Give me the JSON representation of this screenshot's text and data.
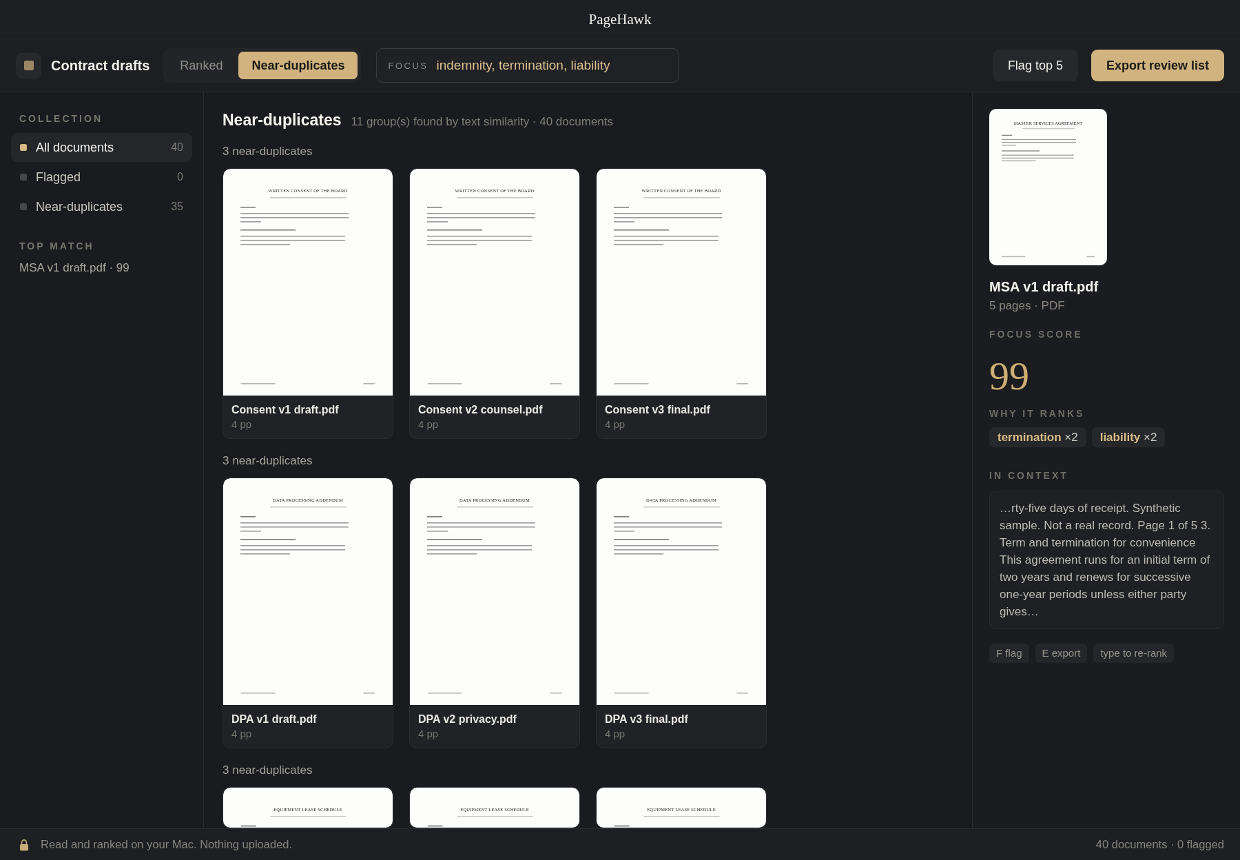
{
  "window": {
    "title": "PageHawk"
  },
  "toolbar": {
    "collection_title": "Contract drafts",
    "view_tabs": [
      {
        "label": "Ranked",
        "selected": false
      },
      {
        "label": "Near-duplicates",
        "selected": true
      }
    ],
    "focus": {
      "label": "FOCUS",
      "value": "indemnity, termination, liability"
    },
    "buttons": [
      {
        "label": "Flag top 5",
        "kind": "secondary"
      },
      {
        "label": "Export review list",
        "kind": "primary"
      }
    ]
  },
  "sidebar": {
    "collection": {
      "heading": "COLLECTION",
      "items": [
        {
          "label": "All documents",
          "count": "40",
          "selected": true
        },
        {
          "label": "Flagged",
          "count": "0",
          "selected": false
        },
        {
          "label": "Near-duplicates",
          "count": "35",
          "selected": false
        }
      ]
    },
    "top_match": {
      "heading": "TOP MATCH",
      "text": "MSA v1 draft.pdf · 99"
    }
  },
  "main": {
    "title": "Near-duplicates",
    "summary": "11 group(s) found by text similarity · 40 documents",
    "groups": [
      {
        "label": "3 near-duplicates",
        "documents": [
          {
            "page_title": "WRITTEN CONSENT OF THE BOARD",
            "name": "Consent v1 draft.pdf",
            "pages": "4 pp"
          },
          {
            "page_title": "WRITTEN CONSENT OF THE BOARD",
            "name": "Consent v2 counsel.pdf",
            "pages": "4 pp"
          },
          {
            "page_title": "WRITTEN CONSENT OF THE BOARD",
            "name": "Consent v3 final.pdf",
            "pages": "4 pp"
          }
        ]
      },
      {
        "label": "3 near-duplicates",
        "documents": [
          {
            "page_title": "DATA PROCESSING ADDENDUM",
            "name": "DPA v1 draft.pdf",
            "pages": "4 pp"
          },
          {
            "page_title": "DATA PROCESSING ADDENDUM",
            "name": "DPA v2 privacy.pdf",
            "pages": "4 pp"
          },
          {
            "page_title": "DATA PROCESSING ADDENDUM",
            "name": "DPA v3 final.pdf",
            "pages": "4 pp"
          }
        ]
      },
      {
        "label": "3 near-duplicates",
        "documents": [
          {
            "page_title": "EQUIPMENT LEASE SCHEDULE"
          },
          {
            "page_title": "EQUIPMENT LEASE SCHEDULE"
          },
          {
            "page_title": "EQUIPMENT LEASE SCHEDULE"
          }
        ]
      }
    ]
  },
  "detail": {
    "preview_title": "MASTER SERVICES AGREEMENT",
    "file_name": "MSA v1 draft.pdf",
    "meta": "5 pages · PDF",
    "score_label": "FOCUS SCORE",
    "score": "99",
    "reasons_label": "WHY IT RANKS",
    "reasons": [
      "**termination** ×2",
      "**liability** ×2"
    ],
    "context_label": "IN CONTEXT",
    "context": "…rty-five days of receipt. Synthetic sample. Not a real record. Page 1 of 5 3. Term and termination for convenience This agreement runs for an initial term of two years and renews for successive one-year periods unless either party gives…",
    "hints": [
      "F flag",
      "E export",
      "type to re-rank"
    ]
  },
  "status_bar": {
    "message": "Read and ranked on your Mac. Nothing uploaded.",
    "summary": "40 documents · 0 flagged"
  }
}
